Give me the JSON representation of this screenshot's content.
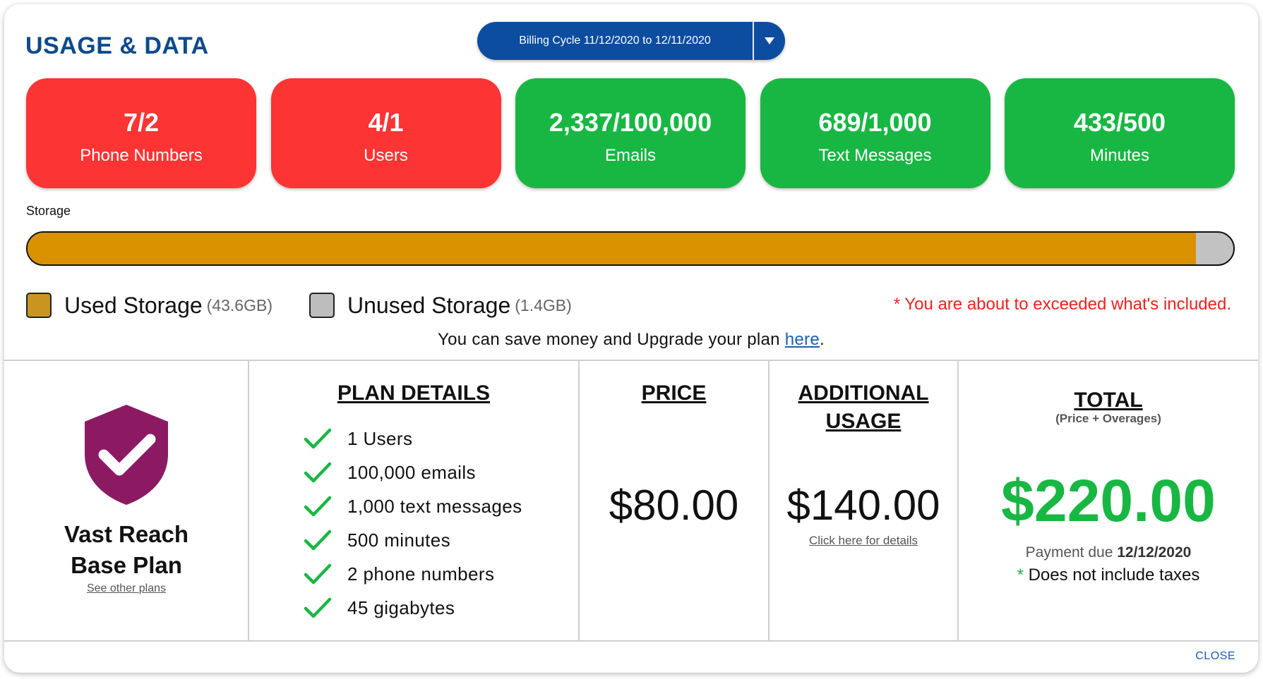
{
  "header": {
    "title": "USAGE & DATA",
    "billing_cycle": "Billing Cycle 11/12/2020 to 12/11/2020"
  },
  "usage_cards": [
    {
      "value": "7/2",
      "label": "Phone Numbers",
      "status": "over",
      "color": "#fc3434"
    },
    {
      "value": "4/1",
      "label": "Users",
      "status": "over",
      "color": "#fc3434"
    },
    {
      "value": "2,337/100,000",
      "label": "Emails",
      "status": "ok",
      "color": "#18b743"
    },
    {
      "value": "689/1,000",
      "label": "Text Messages",
      "status": "ok",
      "color": "#18b743"
    },
    {
      "value": "433/500",
      "label": "Minutes",
      "status": "ok",
      "color": "#18b743"
    }
  ],
  "storage": {
    "label": "Storage",
    "used_fraction": 0.969,
    "used_color": "#d99100",
    "unused_color": "#c2c2c2",
    "used_label": "Used Storage",
    "used_amount": "(43.6GB)",
    "unused_label": "Unused Storage",
    "unused_amount": "(1.4GB)",
    "warning": "* You are about to exceeded what's included."
  },
  "upgrade": {
    "text": "You can save money and Upgrade your plan ",
    "link": "here",
    "suffix": "."
  },
  "plan": {
    "name_line1": "Vast Reach",
    "name_line2": "Base Plan",
    "see_other": "See other plans",
    "shield_icon": "shield-check-icon",
    "shield_color": "#8b1a63"
  },
  "plan_details": {
    "heading": "PLAN DETAILS",
    "items": [
      "1 Users",
      "100,000 emails",
      "1,000 text messages",
      "500 minutes",
      "2 phone numbers",
      "45 gigabytes"
    ]
  },
  "price": {
    "heading": "PRICE",
    "amount": "$80.00"
  },
  "additional": {
    "heading_line1": "ADDITIONAL",
    "heading_line2": "USAGE",
    "amount": "$140.00",
    "details_link": "Click here for details"
  },
  "total": {
    "heading": "TOTAL",
    "subheading": "(Price + Overages)",
    "amount": "$220.00",
    "payment_prefix": "Payment due ",
    "payment_date": "12/12/2020",
    "taxes_star": "*",
    "taxes_note": " Does not include taxes"
  },
  "footer": {
    "close": "CLOSE"
  }
}
